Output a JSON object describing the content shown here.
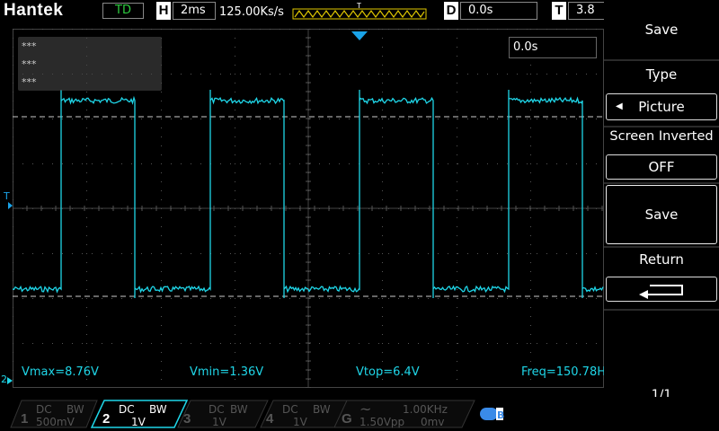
{
  "topbar": {
    "brand": "Hantek",
    "trigger_mode": "TD",
    "horizontal_key": "H",
    "timebase": "2ms",
    "sample_rate": "125.00Ks/s",
    "delay_key": "D",
    "delay_value": "0.0s",
    "trigger_key": "T",
    "trigger_value": "3.8"
  },
  "screen": {
    "info_lines": [
      "***",
      "***",
      "***"
    ],
    "delay_readout": "0.0s",
    "trigger_marker": "T",
    "ground_marker": "2",
    "trace_color": "#1fd6e8",
    "measurements": {
      "vmax": "Vmax=8.76V",
      "vmin": "Vmin=1.36V",
      "vtop": "Vtop=6.4V",
      "freq": "Freq=150.78H"
    }
  },
  "menu": {
    "title": "Save",
    "type_label": "Type",
    "type_value": "Picture",
    "inverted_label": "Screen Inverted",
    "inverted_value": "OFF",
    "save_button": "Save",
    "return_label": "Return",
    "page": "1/1"
  },
  "channels": [
    {
      "num": "1",
      "coupling": "DC",
      "bw": "BW",
      "scale": "500mV",
      "active": false
    },
    {
      "num": "2",
      "coupling": "DC",
      "bw": "BW",
      "scale": "1V",
      "active": true
    },
    {
      "num": "3",
      "coupling": "DC",
      "bw": "BW",
      "scale": "1V",
      "active": false
    },
    {
      "num": "4",
      "coupling": "DC",
      "bw": "BW",
      "scale": "1V",
      "active": false
    }
  ],
  "generator": {
    "key": "G",
    "wave": "~",
    "freq": "1.00KHz",
    "vpp": "1.50Vpp",
    "offset": "0mv"
  },
  "colors": {
    "accent": "#1fd6e8",
    "marker": "#1aa3e8",
    "badge_green": "#2ecc40",
    "usb": "#3a8be8"
  }
}
